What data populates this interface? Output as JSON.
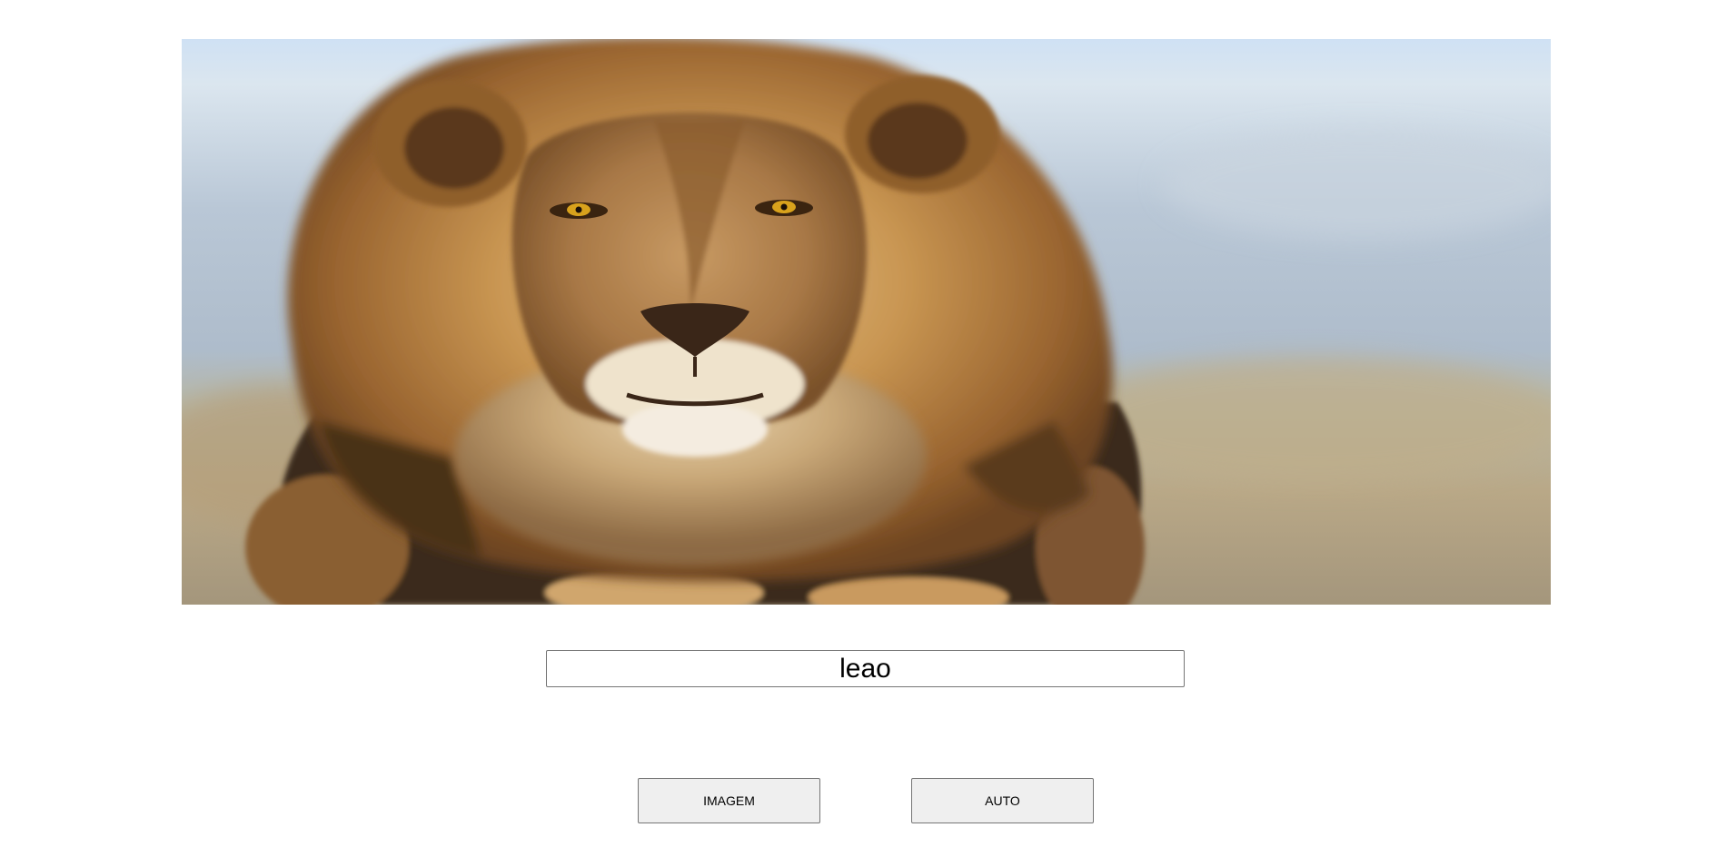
{
  "photo": {
    "subject": "lion-photo",
    "colors": {
      "sky_top": "#cfe1f3",
      "sky_mid": "#b7c6d6",
      "ground": "#b7a686",
      "mane_light": "#d9b47e",
      "mane_mid": "#b07a3c",
      "mane_dark": "#5a3a1e",
      "fur_dark": "#2e2116",
      "eye": "#d8a21c"
    }
  },
  "word_input": {
    "value": "leao"
  },
  "buttons": {
    "imagem_label": "IMAGEM",
    "auto_label": "AUTO"
  }
}
